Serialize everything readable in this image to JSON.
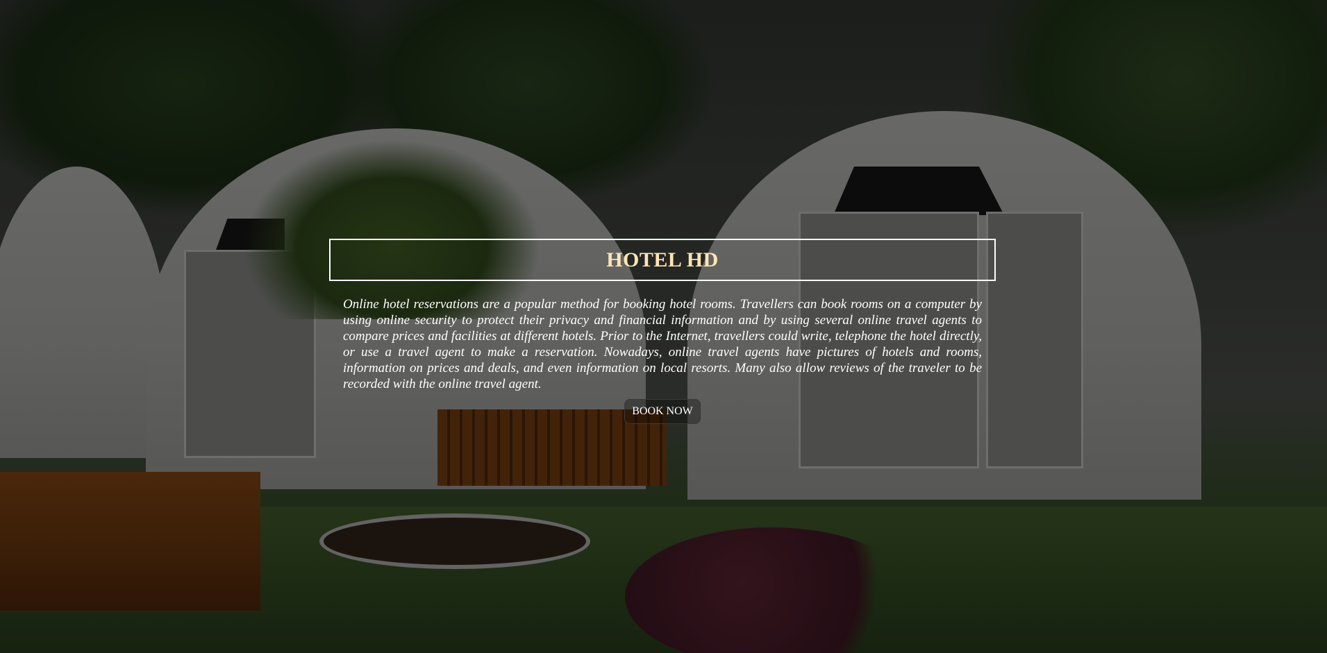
{
  "hero": {
    "title": "HOTEL HD",
    "description": "Online hotel reservations are a popular method for booking hotel rooms. Travellers can book rooms on a computer by using online security to protect their privacy and financial information and by using several online travel agents to compare prices and facilities at different hotels. Prior to the Internet, travellers could write, telephone the hotel directly, or use a travel agent to make a reservation. Nowadays, online travel agents have pictures of hotels and rooms, information on prices and deals, and even information on local resorts. Many also allow reviews of the traveler to be recorded with the online travel agent.",
    "book_button_label": "BOOK NOW"
  },
  "colors": {
    "title_color": "#ffe4b5",
    "text_color": "#ffffff",
    "overlay": "rgba(0,0,0,0.52)"
  }
}
